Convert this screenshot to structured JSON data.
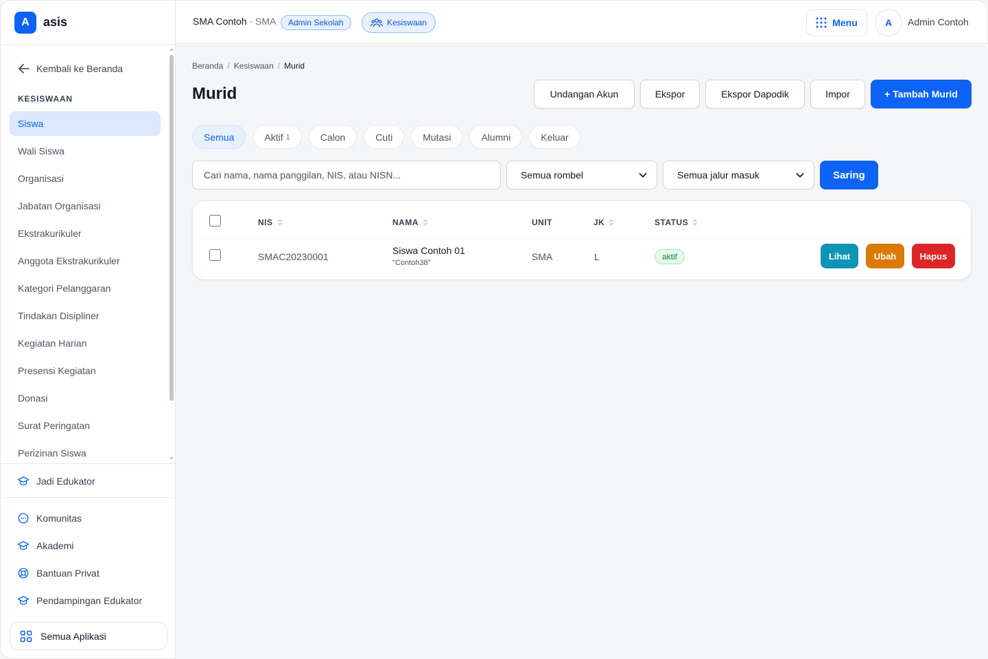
{
  "brand": {
    "logo_letter": "A",
    "name": "asis"
  },
  "sidebar": {
    "back_label": "Kembali ke Beranda",
    "section_title": "KESISWAAN",
    "items": [
      {
        "label": "Siswa",
        "active": true
      },
      {
        "label": "Wali Siswa"
      },
      {
        "label": "Organisasi"
      },
      {
        "label": "Jabatan Organisasi"
      },
      {
        "label": "Ekstrakurikuler"
      },
      {
        "label": "Anggota Ekstrakurikuler"
      },
      {
        "label": "Kategori Pelanggaran"
      },
      {
        "label": "Tindakan Disipliner"
      },
      {
        "label": "Kegiatan Harian"
      },
      {
        "label": "Presensi Kegiatan"
      },
      {
        "label": "Donasi"
      },
      {
        "label": "Surat Peringatan"
      },
      {
        "label": "Perizinan Siswa"
      }
    ],
    "jadi_edukator": "Jadi Edukator",
    "links": [
      {
        "label": "Komunitas",
        "icon": "chat-icon"
      },
      {
        "label": "Akademi",
        "icon": "graduation-cap-icon"
      },
      {
        "label": "Bantuan Privat",
        "icon": "lifebuoy-icon"
      },
      {
        "label": "Pendampingan Edukator",
        "icon": "graduation-cap-icon"
      }
    ],
    "all_apps": "Semua Aplikasi"
  },
  "topbar": {
    "school_name": "SMA Contoh",
    "school_sub": " · SMA",
    "role_badge": "Admin Sekolah",
    "module_badge": "Kesiswaan",
    "menu_label": "Menu",
    "avatar_letter": "A",
    "user_name": "Admin Contoh"
  },
  "breadcrumb": [
    "Beranda",
    "Kesiswaan",
    "Murid"
  ],
  "page_title": "Murid",
  "actions": {
    "invite": "Undangan Akun",
    "export": "Ekspor",
    "export_dapodik": "Ekspor Dapodik",
    "import": "Impor",
    "add": "+ Tambah Murid"
  },
  "tabs": [
    {
      "label": "Semua",
      "active": true
    },
    {
      "label": "Aktif",
      "count": "1"
    },
    {
      "label": "Calon"
    },
    {
      "label": "Cuti"
    },
    {
      "label": "Mutasi"
    },
    {
      "label": "Alumni"
    },
    {
      "label": "Keluar"
    }
  ],
  "filters": {
    "search_placeholder": "Cari nama, nama panggilan, NIS, atau NISN...",
    "rombel": "Semua rombel",
    "jalur": "Semua jalur masuk",
    "submit": "Saring"
  },
  "table": {
    "headers": {
      "nis": "NIS",
      "nama": "NAMA",
      "unit": "UNIT",
      "jk": "JK",
      "status": "STATUS"
    },
    "rows": [
      {
        "nis": "SMAC20230001",
        "nama": "Siswa Contoh 01",
        "panggilan": "\"Contoh38\"",
        "unit": "SMA",
        "jk": "L",
        "status": "aktif",
        "view": "Lihat",
        "edit": "Ubah",
        "delete": "Hapus"
      }
    ]
  },
  "colors": {
    "primary": "#0d63f3",
    "view": "#0e94b6",
    "edit": "#dc7a06",
    "delete": "#dc2626",
    "active_status": "#15803d"
  }
}
